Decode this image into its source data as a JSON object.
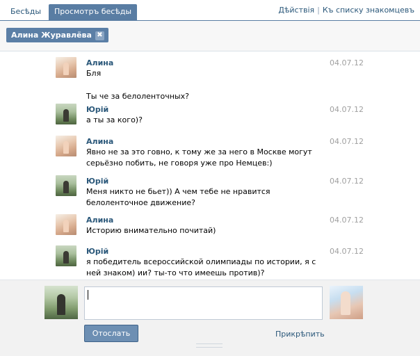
{
  "tabs": [
    {
      "label": "Бесѣды",
      "active": false
    },
    {
      "label": "Просмотръ бесѣды",
      "active": true
    }
  ],
  "top_links": {
    "actions": "Дѣйствія",
    "separator": "|",
    "back_to_list": "Къ списку знакомцевъ"
  },
  "recipient_chip": {
    "name": "Алина Журавлёва",
    "remove_icon": "close-icon",
    "remove_glyph": "✖"
  },
  "messages": [
    {
      "author": "Алина",
      "avatar": "alina",
      "date": "04.07.12",
      "text": "Бля"
    },
    {
      "author": "",
      "avatar": "",
      "date": "",
      "text": "Ты че за белоленточных?"
    },
    {
      "author": "Юрій",
      "avatar": "yuri",
      "date": "04.07.12",
      "text": "а ты за кого)?"
    },
    {
      "author": "Алина",
      "avatar": "alina",
      "date": "04.07.12",
      "text": "Явно не за это говно, к тому же за него в Москве могут серьёзно побить, не говоря уже про Немцев:)"
    },
    {
      "author": "Юрій",
      "avatar": "yuri",
      "date": "04.07.12",
      "text": "Меня никто не бьет)) А чем тебе не нравится белоленточное движение?"
    },
    {
      "author": "Алина",
      "avatar": "alina",
      "date": "04.07.12",
      "text": "Историю внимательно почитай)"
    },
    {
      "author": "Юрій",
      "avatar": "yuri",
      "date": "04.07.12",
      "text": "я победитель всероссийской олимпиады по истории, я с ней знаком) ии? ты-то что имеешь против)?"
    }
  ],
  "composer": {
    "input_value": "",
    "send_label": "Отослать",
    "attach_label": "Прикрѣпить"
  },
  "colors": {
    "link": "#2b587a",
    "accent": "#597da3",
    "button": "#6d8fb3",
    "date": "#a0a0a0"
  }
}
